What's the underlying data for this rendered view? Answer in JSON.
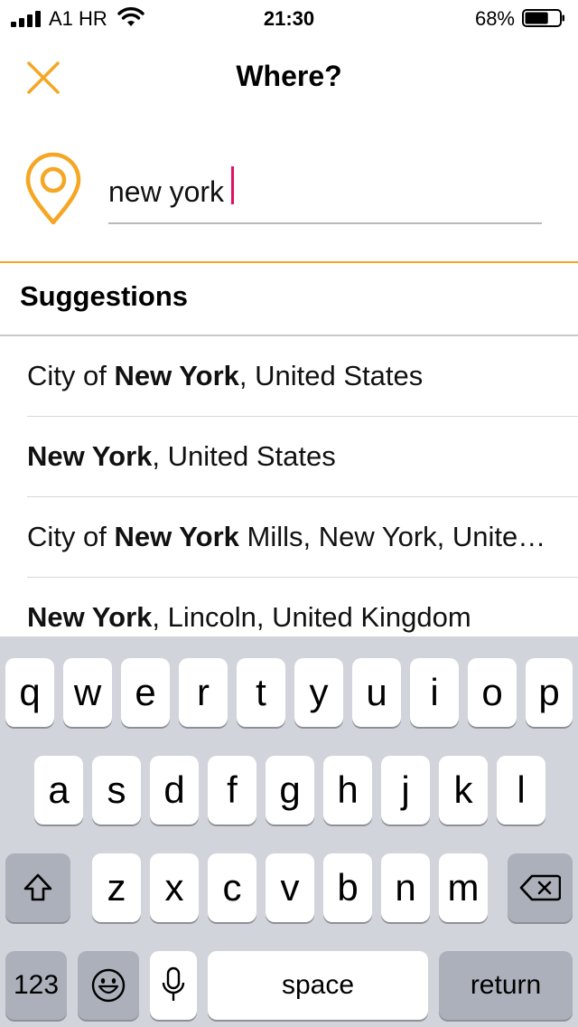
{
  "status_bar": {
    "carrier": "A1 HR",
    "time": "21:30",
    "battery_percent": "68%",
    "battery_level": 0.68,
    "icons": [
      "signal-icon",
      "wifi-icon",
      "battery-icon"
    ]
  },
  "header": {
    "title": "Where?",
    "close_icon": "close-icon"
  },
  "search": {
    "value": "new york",
    "icon": "map-pin-icon"
  },
  "suggestions": {
    "heading": "Suggestions",
    "items": [
      {
        "before": "City of ",
        "bold": "New York",
        "after": ", United States"
      },
      {
        "before": "",
        "bold": "New York",
        "after": ", United States"
      },
      {
        "before": "City of ",
        "bold": "New York",
        "after": " Mills, New York, United States"
      },
      {
        "before": "",
        "bold": "New York",
        "after": ", Lincoln, United Kingdom"
      }
    ]
  },
  "keyboard": {
    "row1": [
      "q",
      "w",
      "e",
      "r",
      "t",
      "y",
      "u",
      "i",
      "o",
      "p"
    ],
    "row2": [
      "a",
      "s",
      "d",
      "f",
      "g",
      "h",
      "j",
      "k",
      "l"
    ],
    "row3": [
      "z",
      "x",
      "c",
      "v",
      "b",
      "n",
      "m"
    ],
    "numbers_label": "123",
    "space_label": "space",
    "return_label": "return"
  },
  "colors": {
    "accent": "#F5A623",
    "caret": "#E0115F",
    "keyboard_bg": "#D1D4DA",
    "dark_key": "#ABB0BA"
  }
}
